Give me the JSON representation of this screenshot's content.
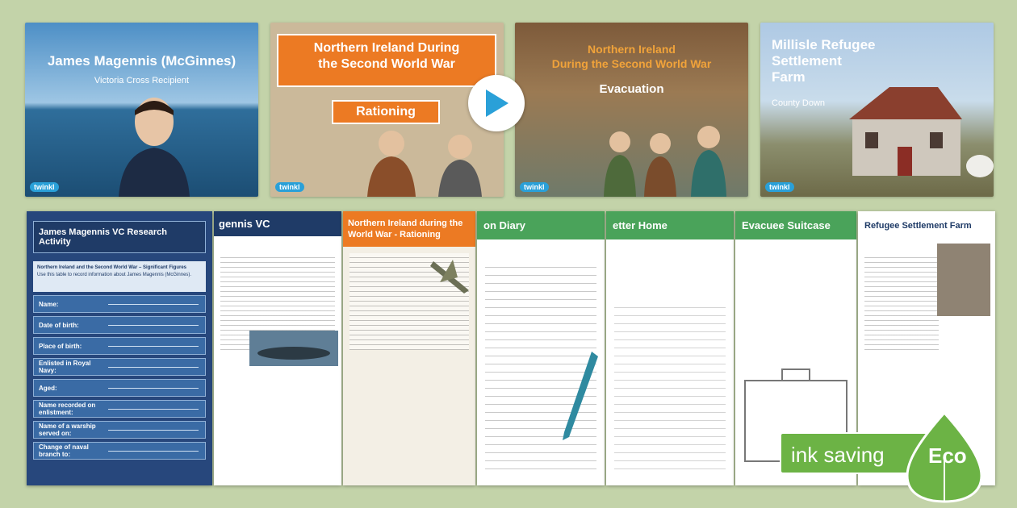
{
  "slides": [
    {
      "title": "James Magennis (McGinnes)",
      "subtitle": "Victoria Cross Recipient",
      "logo": "twinkl"
    },
    {
      "title_line1": "Northern Ireland During",
      "title_line2": "the Second World War",
      "subtitle": "Rationing",
      "logo": "twinkl"
    },
    {
      "title_line1": "Northern Ireland",
      "title_line2": "During the Second World War",
      "subtitle": "Evacuation",
      "logo": "twinkl"
    },
    {
      "title_line1": "Millisle Refugee",
      "title_line2": "Settlement",
      "title_line3": "Farm",
      "subtitle": "County Down",
      "logo": "twinkl"
    }
  ],
  "play_icon": "play-icon",
  "docs": {
    "research": {
      "title": "James Magennis VC Research Activity",
      "intro_heading": "Northern Ireland and the Second World War – Significant Figures",
      "intro_text": "Use this table to record information about James Magennis (McGinnes).",
      "fields": [
        "Name:",
        "Date of birth:",
        "Place of birth:",
        "Enlisted in Royal Navy:",
        "Aged:",
        "Name recorded on enlistment:",
        "Name of a warship served on:",
        "Change of naval branch to:"
      ]
    },
    "vc": {
      "title": "gennis VC"
    },
    "rationing": {
      "title_line1": "Northern Ireland during the",
      "title_line2": "World War - Rationing"
    },
    "diary": {
      "title": "on Diary"
    },
    "letter": {
      "title": "etter Home"
    },
    "suitcase": {
      "title": "Evacuee Suitcase"
    },
    "farm": {
      "title": "Refugee Settlement Farm"
    }
  },
  "badge": {
    "label": "ink saving",
    "eco": "Eco",
    "color": "#6cb345"
  }
}
